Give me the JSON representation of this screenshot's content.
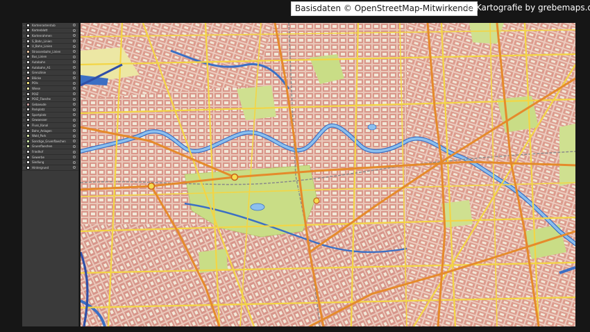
{
  "credits": {
    "osm": "Basisdaten © OpenStreetMap-Mitwirkende",
    "carto": "© Kartografie by grebemaps.de"
  },
  "layers_panel": {
    "layers": [
      {
        "label": "Kartenrasterstub",
        "swatch": "#e0e0e0"
      },
      {
        "label": "Kartenblatt",
        "swatch": "#ffffff"
      },
      {
        "label": "Kartenrahmen",
        "swatch": "#d8d8d8"
      },
      {
        "label": "S_Bahn_Linien",
        "swatch": "#d9d9d9"
      },
      {
        "label": "U_Bahn_Linien",
        "swatch": "#cfcfcf"
      },
      {
        "label": "Strassenbahn_Linien",
        "swatch": "#e6c3a0"
      },
      {
        "label": "Bus_Linien",
        "swatch": "#c9c9c9"
      },
      {
        "label": "Autobahn",
        "swatch": "#e3e3e3"
      },
      {
        "label": "Autobahn_A1",
        "swatch": "#dedede"
      },
      {
        "label": "Grenzlinie",
        "swatch": "#e0e0e0"
      },
      {
        "label": "Blöcke",
        "swatch": "#e4c6be"
      },
      {
        "label": "POIs",
        "swatch": "#f2e27a"
      },
      {
        "label": "Wiese",
        "swatch": "#f7f0a8"
      },
      {
        "label": "POIZ",
        "swatch": "#d5d5d5"
      },
      {
        "label": "POIZ_Flaeche",
        "swatch": "#d0d0d0"
      },
      {
        "label": "Gebaeude",
        "swatch": "#c69a9a"
      },
      {
        "label": "Parkplatz",
        "swatch": "#d0d0d0"
      },
      {
        "label": "Sportplatz",
        "swatch": "#d3d3d3"
      },
      {
        "label": "Gewaesser",
        "swatch": "#cfcfcf"
      },
      {
        "label": "Fluss_Kanal",
        "swatch": "#d4d4d4"
      },
      {
        "label": "Bahn_Anlagen",
        "swatch": "#d9d9d9"
      },
      {
        "label": "Wald_Park",
        "swatch": "#cfe0a0"
      },
      {
        "label": "Sonstige_Gruenflaechen",
        "swatch": "#c4dfa0"
      },
      {
        "label": "Gruenflaechen",
        "swatch": "#d6e8b0"
      },
      {
        "label": "Friedhof",
        "swatch": "#d8d8d8"
      },
      {
        "label": "Gewerbe",
        "swatch": "#e0e0e0"
      },
      {
        "label": "Siedlung",
        "swatch": "#ececec"
      },
      {
        "label": "Hintergrund",
        "swatch": "#f5f5f5"
      }
    ]
  },
  "map": {
    "colors": {
      "background": "#f1e8d8",
      "blocks": "#e0a89a",
      "street_major": "#f5dd50",
      "street_primary": "#e58a2b",
      "highway": "#c8601a",
      "water": "#7fb3e6",
      "water_edge": "#3b6fc4",
      "park": "#c9dd86",
      "forest": "#b5d272",
      "rail": "#8a8a8a"
    }
  }
}
